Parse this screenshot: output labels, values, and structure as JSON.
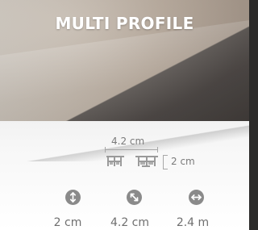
{
  "header": {
    "title": "MULTI PROFILE"
  },
  "dimensions": {
    "width_label": "4.2 cm",
    "height_label": "2 cm"
  },
  "metrics": [
    {
      "icon": "height-icon",
      "value": "2 cm"
    },
    {
      "icon": "width-icon",
      "value": "4.2 cm"
    },
    {
      "icon": "length-icon",
      "value": "2.4 m"
    }
  ],
  "colors": {
    "icon_bg": "#8a8a8a",
    "text_gray": "#6f6f6f",
    "title_text": "#ffffff"
  }
}
